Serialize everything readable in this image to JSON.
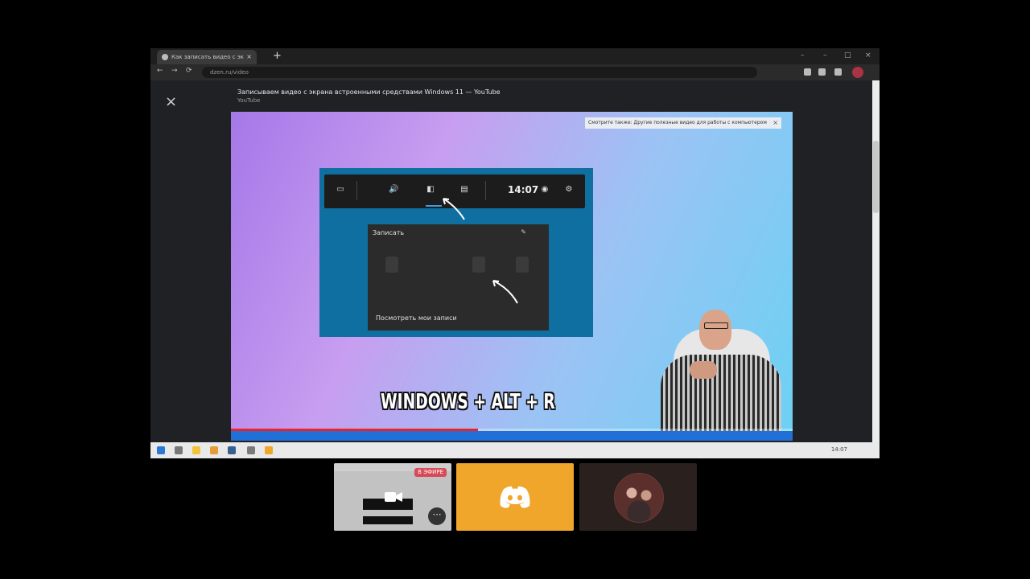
{
  "browser": {
    "tab_title": "Как записать видео с экрана",
    "tab_close": "×",
    "new_tab": "+",
    "window_controls": [
      "–",
      "–",
      "□",
      "×"
    ],
    "nav": [
      "←",
      "→",
      "⟳"
    ],
    "address": "dzen.ru/video",
    "colors": {
      "tabbar": "#1f1f1f",
      "toolbar": "#2b2b2b"
    }
  },
  "page": {
    "close_icon": "×",
    "video_title": "Записываем видео с экрана встроенными средствами Windows 11 — YouTube",
    "video_subtitle": "YouTube"
  },
  "video": {
    "overlay_text": "Смотрите также: Другие полезные видео для работы с компьютером",
    "overlay_close": "×",
    "gamebar": {
      "clock": "14:07",
      "panel_title": "Записать",
      "panel_footer": "Посмотреть мои записи"
    },
    "hotkey_caption": "WINDOWS + ALT + R",
    "progress": 0.44,
    "colors": {
      "gamebar": "#0e6fa0",
      "progress": "#e22222"
    }
  },
  "taskbar": {
    "clock": "14:07"
  },
  "tiles": {
    "share": {
      "badge": "В ЭФИРЕ",
      "more": "⋯",
      "icon": "camera-icon"
    },
    "discord": {
      "icon": "discord-icon",
      "color": "#f0a52b"
    },
    "user": {
      "icon": "avatar"
    }
  }
}
